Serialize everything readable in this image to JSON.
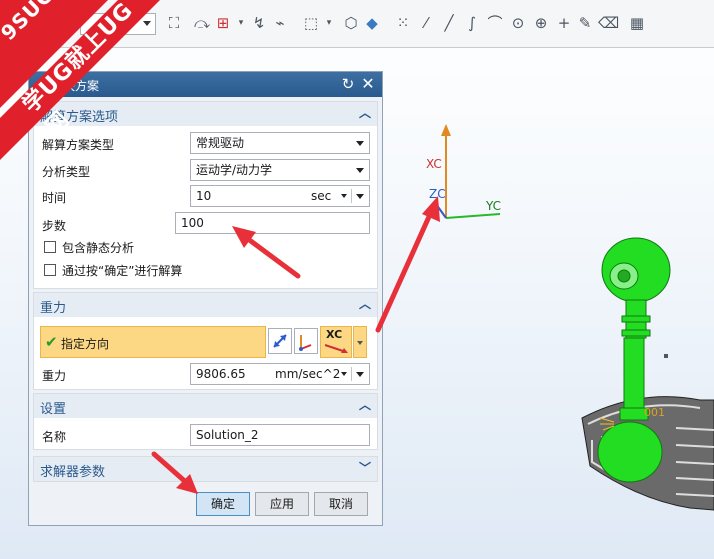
{
  "watermark": {
    "line1": "9SUG",
    "line2": "学UG就上UG网",
    "color": "#e0202a"
  },
  "dialog": {
    "title": "决方案",
    "sections": {
      "solution_options": {
        "header": "解算方案选项",
        "solution_type_label": "解算方案类型",
        "solution_type_value": "常规驱动",
        "analysis_type_label": "分析类型",
        "analysis_type_value": "运动学/动力学",
        "time_label": "时间",
        "time_value": "10",
        "time_unit": "sec",
        "steps_label": "步数",
        "steps_value": "100",
        "static_checkbox_label": "包含静态分析",
        "confirm_checkbox_label": "通过按“确定”进行解算"
      },
      "gravity": {
        "header": "重力",
        "direction_label": "指定方向",
        "xc_label": "XC",
        "gravity_label": "重力",
        "gravity_value": "9806.65",
        "gravity_unit": "mm/sec^2"
      },
      "settings": {
        "header": "设置",
        "name_label": "名称",
        "name_value": "Solution_2"
      },
      "solver_params": {
        "header": "求解器参数"
      }
    },
    "buttons": {
      "ok": "确定",
      "apply": "应用",
      "cancel": "取消"
    }
  },
  "viewport": {
    "axis_xc": "XC",
    "axis_zc": "ZC",
    "axis_yc": "YC",
    "part_label": "001"
  },
  "colors": {
    "accent_blue": "#2a5a8d",
    "highlight_yellow": "#fdd884",
    "part_green": "#22dd22",
    "annotation_red": "#e8303a"
  }
}
